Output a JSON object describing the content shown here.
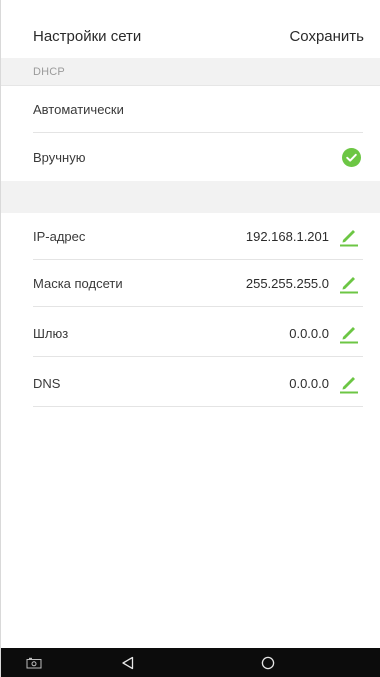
{
  "header": {
    "title": "Настройки сети",
    "save_label": "Сохранить"
  },
  "dhcp_section": {
    "label": "DHCP"
  },
  "mode_options": [
    {
      "label": "Автоматически",
      "selected": false
    },
    {
      "label": "Вручную",
      "selected": true
    }
  ],
  "network_fields": [
    {
      "label": "IP-адрес",
      "value": "192.168.1.201"
    },
    {
      "label": "Маска подсети",
      "value": "255.255.255.0"
    },
    {
      "label": "Шлюз",
      "value": "0.0.0.0"
    },
    {
      "label": "DNS",
      "value": "0.0.0.0"
    }
  ],
  "colors": {
    "accent_green": "#6cc644",
    "navbar": "#0c0c0c",
    "section_bg": "#f2f2f2"
  },
  "icons": {
    "selected": "check-circle-icon",
    "edit": "pencil-icon",
    "nav_left": "screenshot-icon",
    "nav_back": "back-triangle-icon",
    "nav_home": "home-circle-icon"
  }
}
